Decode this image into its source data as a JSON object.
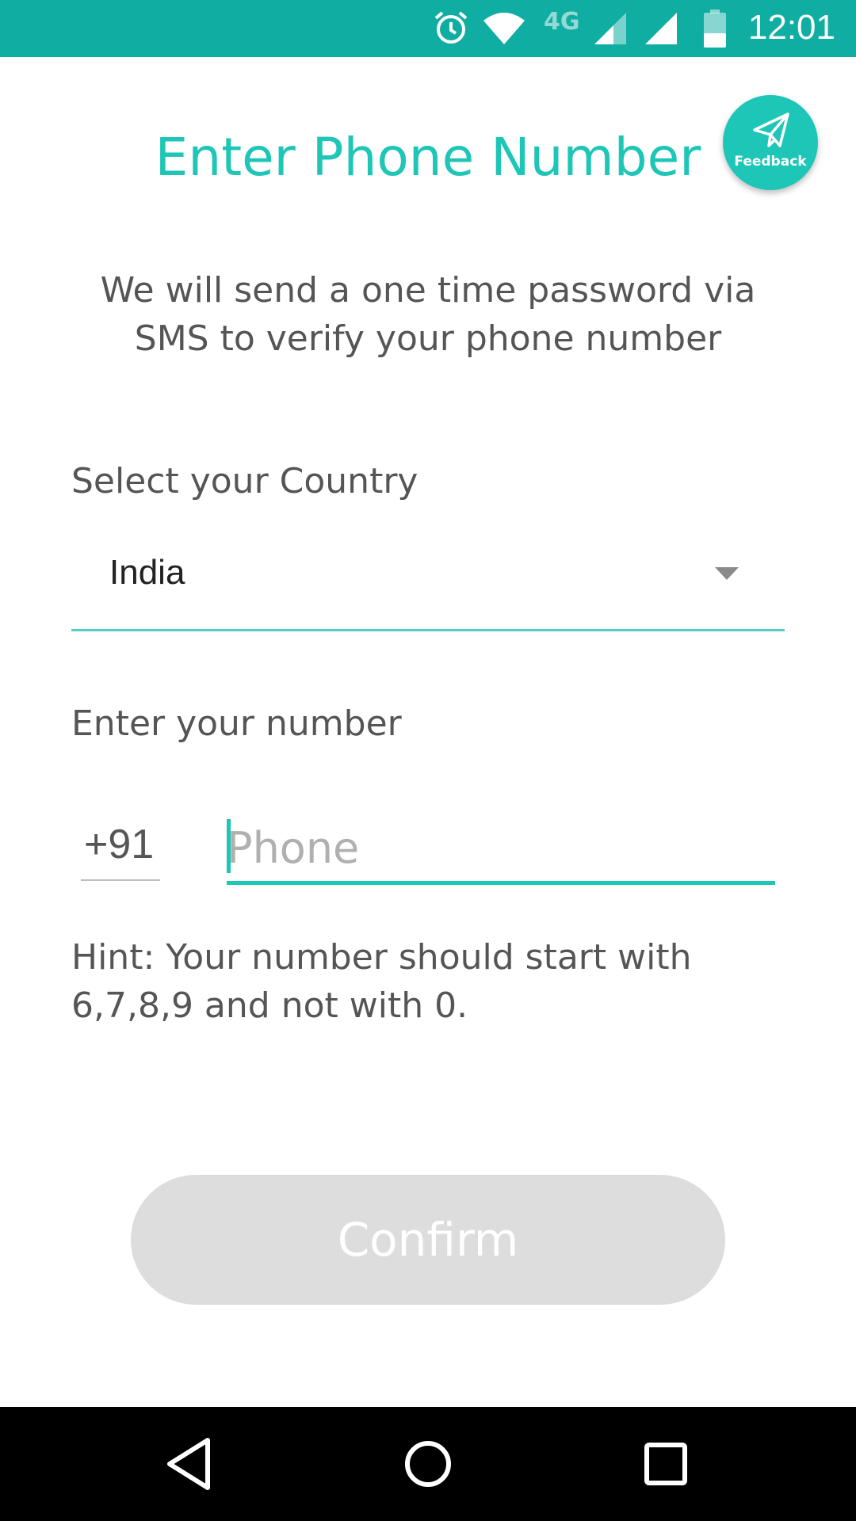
{
  "status_bar": {
    "network_label": "4G",
    "time": "12:01",
    "icons": [
      "alarm-icon",
      "wifi-icon",
      "signal-icon",
      "signal-icon",
      "battery-icon"
    ]
  },
  "header": {
    "title": "Enter Phone Number",
    "feedback_label": "Feedback",
    "feedback_icon": "paper-plane-icon"
  },
  "intro": {
    "text": "We will send a one time password via SMS to verify your phone number"
  },
  "country": {
    "label": "Select your Country",
    "selected": "India"
  },
  "phone": {
    "label": "Enter your number",
    "dial_code": "+91",
    "value": "",
    "placeholder": "Phone"
  },
  "hint": {
    "text": "Hint: Your number should start with 6,7,8,9 and not with 0."
  },
  "confirm": {
    "label": "Confirm"
  },
  "nav_bar": {
    "buttons": [
      "back-icon",
      "home-icon",
      "recents-icon"
    ]
  },
  "colors": {
    "accent": "#1ec6b7",
    "status_bar": "#10ada3",
    "button_disabled": "#dddddd",
    "text": "#555555"
  }
}
